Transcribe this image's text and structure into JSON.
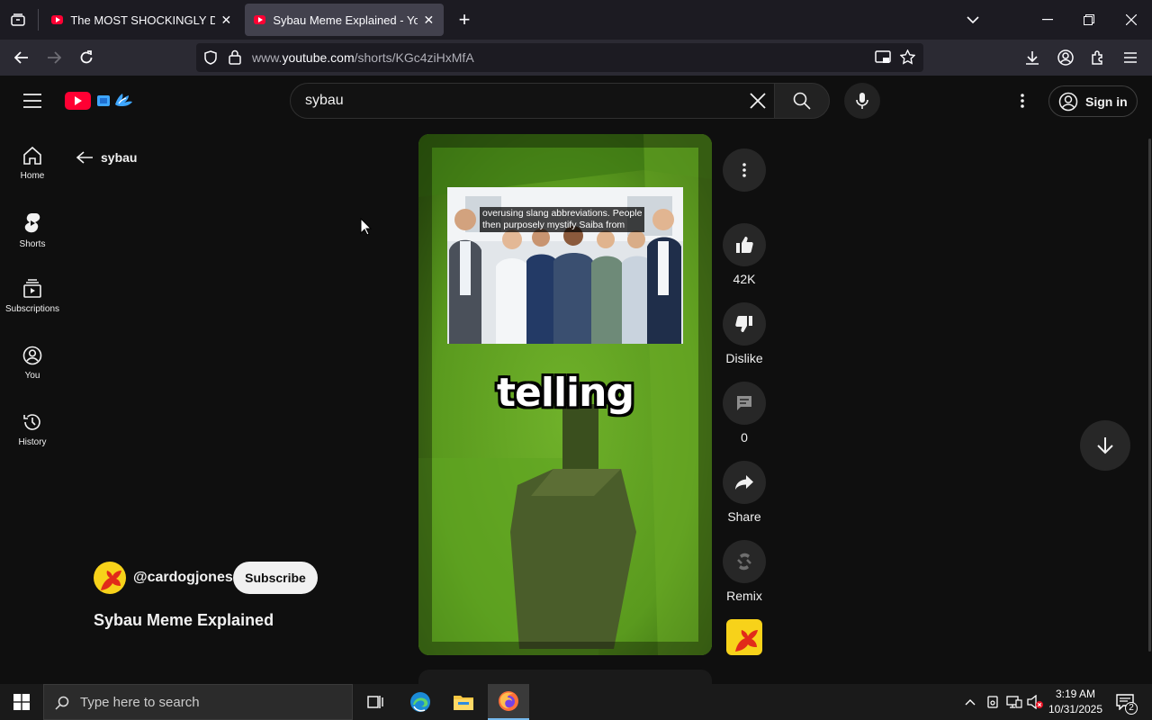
{
  "browser": {
    "tabs": [
      {
        "title": "The MOST SHOCKINGLY Dirty C",
        "active": false
      },
      {
        "title": "Sybau Meme Explained - YouTu",
        "active": true
      }
    ],
    "url_prefix": "www.",
    "url_domain": "youtube.com",
    "url_path": "/shorts/KGc4ziHxMfA"
  },
  "header": {
    "search_value": "sybau",
    "signin_label": "Sign in"
  },
  "guide": {
    "items": [
      {
        "label": "Home",
        "icon": "home-icon"
      },
      {
        "label": "Shorts",
        "icon": "shorts-icon"
      },
      {
        "label": "Subscriptions",
        "icon": "subscriptions-icon"
      },
      {
        "label": "You",
        "icon": "you-icon"
      },
      {
        "label": "History",
        "icon": "history-icon"
      }
    ]
  },
  "shorts": {
    "back_label": "sybau",
    "channel_handle": "@cardogjones",
    "subscribe_label": "Subscribe",
    "video_title": "Sybau Meme Explained",
    "caption_line1": "overusing slang abbreviations. People",
    "caption_line2": "then purposely mystify Saiba from",
    "overlay_word": "telling",
    "actions": {
      "likes": "42K",
      "dislike": "Dislike",
      "comments": "0",
      "share": "Share",
      "remix": "Remix"
    }
  },
  "taskbar": {
    "search_placeholder": "Type here to search",
    "time": "3:19 AM",
    "date": "10/31/2025",
    "notifications": "2"
  },
  "colors": {
    "yt_red": "#ff0033",
    "background": "#0f0f0f",
    "video_green": "#5a9a1e"
  }
}
